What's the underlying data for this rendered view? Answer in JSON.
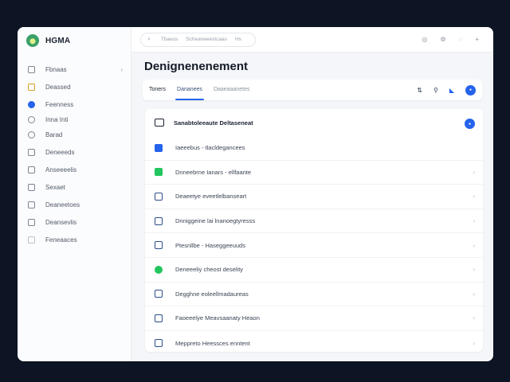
{
  "app": {
    "name": "HGMA"
  },
  "sidebar": {
    "items": [
      {
        "label": "Fbnaas",
        "icon": "dashboard-icon",
        "chevron": "›"
      },
      {
        "label": "Deassed",
        "icon": "box-icon",
        "chevron": ""
      },
      {
        "label": "Feenness",
        "icon": "globe-icon",
        "chevron": ""
      },
      {
        "label": "Inna Inti",
        "icon": "settings-icon",
        "chevron": ""
      },
      {
        "label": "Barad",
        "icon": "clock-icon",
        "chevron": ""
      },
      {
        "label": "Deneeeds",
        "icon": "calendar-icon",
        "chevron": ""
      },
      {
        "label": "Anseeeelis",
        "icon": "folder-icon",
        "chevron": ""
      },
      {
        "label": "Sexaet",
        "icon": "mail-icon",
        "chevron": ""
      },
      {
        "label": "Deaneetoes",
        "icon": "grid-icon",
        "chevron": ""
      },
      {
        "label": "Deansevlis",
        "icon": "chart-icon",
        "chevron": ""
      },
      {
        "label": "Feneaaces",
        "icon": "document-icon",
        "chevron": ""
      }
    ]
  },
  "topbar": {
    "search_icon": "⌕",
    "search_text": "Tbaess",
    "search_field": "Scheaneeestcaas",
    "search_shortcut": "Hs",
    "icons": [
      "◎",
      "⚙",
      "◌",
      "+"
    ]
  },
  "page": {
    "title": "Denignenenement"
  },
  "tabs": {
    "items": [
      {
        "label": "Toners"
      },
      {
        "label": "Dananees"
      },
      {
        "label": "Daaeaaanetes"
      }
    ],
    "actions": [
      "⇅",
      "⚲",
      "◣",
      "●"
    ]
  },
  "list": {
    "header_title": "Sanabtoleeaute Deltaseneat",
    "header_button": "●",
    "rows": [
      {
        "label": "Iaeeebus - tlacldegancees",
        "icon_style": "blue",
        "icon": "calendar-icon"
      },
      {
        "label": "Dnneebrne   Ianars - ellfaante",
        "icon_style": "green",
        "icon": "check-icon"
      },
      {
        "label": "Deaeetye   eveetlelbanseart",
        "icon_style": "outline",
        "icon": "document-icon"
      },
      {
        "label": "Dnniggeine lai lnanoegtyresss",
        "icon_style": "outline",
        "icon": "image-icon"
      },
      {
        "label": "Ptesnllbe - Haseggeeuuds",
        "icon_style": "outline",
        "icon": "chart-icon"
      },
      {
        "label": "Deneeeliy  cheost deselity",
        "icon_style": "greendot",
        "icon": "circle-icon"
      },
      {
        "label": "Degghne eoleellmadaureas",
        "icon_style": "outline",
        "icon": "flag-icon"
      },
      {
        "label": "Faoeeelye Meavsaanaty Heaon",
        "icon_style": "outline",
        "icon": "alert-icon"
      },
      {
        "label": "Meppreto Heessces enntent",
        "icon_style": "outline",
        "icon": "file-icon"
      }
    ],
    "chevron": "›"
  },
  "colors": {
    "accent": "#2563eb",
    "success": "#22c55e",
    "background": "#0d1424"
  }
}
